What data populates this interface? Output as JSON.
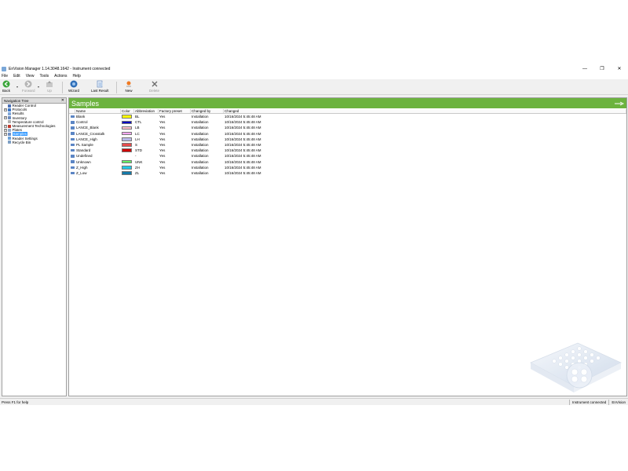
{
  "window": {
    "title": "EnVision Manager 1.14.3048.1642 - Instrument connected",
    "controls": {
      "minimize": "—",
      "restore": "❐",
      "close": "✕"
    }
  },
  "menu": [
    "File",
    "Edit",
    "View",
    "Tools",
    "Actions",
    "Help"
  ],
  "toolbar": {
    "back": "Back",
    "forward": "Forward",
    "up": "Up",
    "wizard": "Wizard",
    "last_result": "Last Result",
    "new": "New",
    "delete": "Delete"
  },
  "nav": {
    "title": "Navigation Tree",
    "close": "✕",
    "items": [
      {
        "label": "Reader Control",
        "expander": "",
        "color": "#4a6fb5"
      },
      {
        "label": "Protocols",
        "expander": "+",
        "color": "#3c78c8"
      },
      {
        "label": "Results",
        "expander": "",
        "color": "#7fa7d9"
      },
      {
        "label": "Inventory",
        "expander": "+",
        "color": "#6c8bbd"
      },
      {
        "label": "Temperature control",
        "expander": "",
        "color": "#b0b0b0"
      },
      {
        "label": "Measurement Technologies",
        "expander": "+",
        "color": "#c0392b"
      },
      {
        "label": "Plates",
        "expander": "+",
        "color": "#8fa8c8"
      },
      {
        "label": "Samples",
        "expander": "+",
        "color": "#6c8fc5",
        "selected": true
      },
      {
        "label": "Reader Settings",
        "expander": "",
        "color": "#6aa0d8"
      },
      {
        "label": "Recycle Bin",
        "expander": "",
        "color": "#7d9fc4"
      }
    ]
  },
  "main": {
    "title": "Samples",
    "columns": [
      "Name",
      "Color",
      "Abbreviation",
      "Factory preset",
      "Changed by",
      "Changed"
    ],
    "rows": [
      {
        "name": "Blank",
        "color": "#ffff00",
        "abbr": "BL",
        "preset": "Yes",
        "by": "Installation",
        "changed": "10/16/2024 5:45:48 AM"
      },
      {
        "name": "Control",
        "color": "#0000c0",
        "abbr": "CTL",
        "preset": "Yes",
        "by": "Installation",
        "changed": "10/16/2024 5:45:48 AM"
      },
      {
        "name": "LANCE_Blank",
        "color": "#ffc0cb",
        "abbr": "LB",
        "preset": "Yes",
        "by": "Installation",
        "changed": "10/16/2024 5:45:48 AM"
      },
      {
        "name": "LANCE_Crosstalk",
        "color": "#f4a6f0",
        "abbr": "LC",
        "preset": "Yes",
        "by": "Installation",
        "changed": "10/16/2024 5:45:48 AM"
      },
      {
        "name": "LANCE_High",
        "color": "#b8b8e8",
        "abbr": "LH",
        "preset": "Yes",
        "by": "Installation",
        "changed": "10/16/2024 5:45:48 AM"
      },
      {
        "name": "PL Sample",
        "color": "#e74c4c",
        "abbr": "S",
        "preset": "Yes",
        "by": "Installation",
        "changed": "10/16/2024 5:45:48 AM"
      },
      {
        "name": "Standard",
        "color": "#cc0000",
        "abbr": "STD",
        "preset": "Yes",
        "by": "Installation",
        "changed": "10/16/2024 5:45:48 AM"
      },
      {
        "name": "Undefined",
        "color": "",
        "abbr": "-",
        "preset": "Yes",
        "by": "Installation",
        "changed": "10/16/2024 5:45:48 AM"
      },
      {
        "name": "Unknown",
        "color": "#66ee66",
        "abbr": "UNK",
        "preset": "Yes",
        "by": "Installation",
        "changed": "10/16/2024 5:45:48 AM"
      },
      {
        "name": "Z_High",
        "color": "#22c7e6",
        "abbr": "ZH",
        "preset": "Yes",
        "by": "Installation",
        "changed": "10/16/2024 5:45:48 AM"
      },
      {
        "name": "Z_Low",
        "color": "#1479a8",
        "abbr": "ZL",
        "preset": "Yes",
        "by": "Installation",
        "changed": "10/16/2024 5:45:48 AM"
      }
    ]
  },
  "status": {
    "help": "Press F1 for help",
    "connection": "Instrument connected",
    "product": "EnVision"
  },
  "colors": {
    "header_green": "#6cb33f",
    "selection": "#3399ff"
  }
}
